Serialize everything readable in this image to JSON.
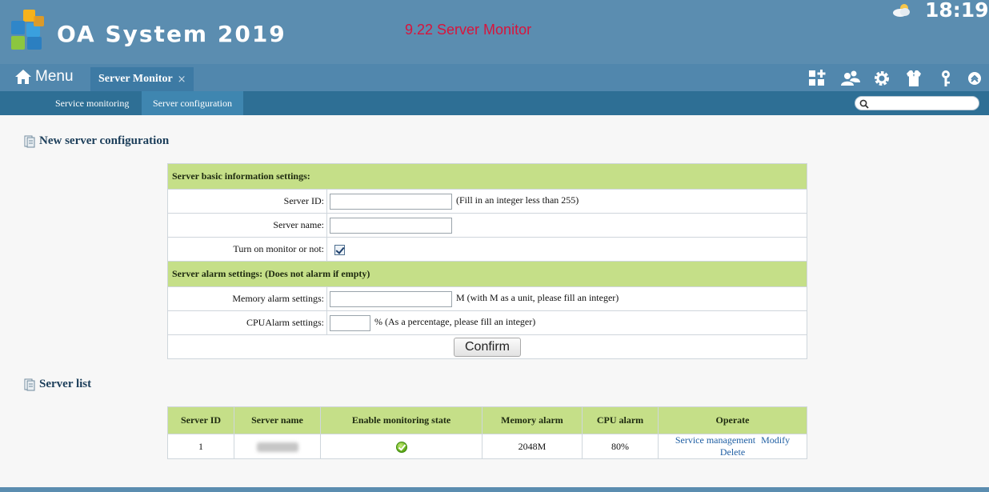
{
  "header": {
    "app_title": "OA System 2019",
    "page_caption": "9.22  Server Monitor",
    "clock": "18:19",
    "weather_icon": "partly-cloudy-icon"
  },
  "nav": {
    "menu_label": "Menu",
    "tab_label": "Server Monitor",
    "tab_close": "×",
    "tools": [
      "apps-add-icon",
      "users-icon",
      "gear-icon",
      "shirt-icon",
      "key-icon",
      "collapse-up-icon"
    ]
  },
  "subnav": {
    "items": [
      "Service monitoring",
      "Server configuration"
    ],
    "active": 1,
    "search_placeholder": ""
  },
  "config_section": {
    "title": "New server configuration",
    "basic_group": "Server basic information settings:",
    "server_id_label": "Server ID:",
    "server_id_value": "",
    "server_id_hint": "(Fill in an integer less than 255)",
    "server_name_label": "Server name:",
    "server_name_value": "",
    "monitor_label": "Turn on monitor or not:",
    "monitor_checked": true,
    "alarm_group": "Server alarm settings: (Does not alarm if empty)",
    "memory_label": "Memory alarm settings:",
    "memory_value": "",
    "memory_hint": "M (with M as a unit, please fill an integer)",
    "cpu_label": "CPUAlarm settings:",
    "cpu_value": "",
    "cpu_hint": "% (As a percentage, please fill an integer)",
    "confirm_label": "Confirm"
  },
  "list_section": {
    "title": "Server list",
    "columns": [
      "Server ID",
      "Server name",
      "Enable monitoring state",
      "Memory alarm",
      "CPU alarm",
      "Operate"
    ],
    "rows": [
      {
        "server_id": "1",
        "server_name": "",
        "monitoring_state_icon": "check-ok-icon",
        "memory_alarm": "2048M",
        "cpu_alarm": "80%",
        "actions": [
          "Service management",
          "Modify",
          "Delete"
        ]
      }
    ]
  },
  "colors": {
    "header_bg": "#5b8db0",
    "subnav_bg": "#2e6f95",
    "caption_red": "#d8143c",
    "group_green": "#c5df88",
    "link_blue": "#1e5ea3"
  }
}
